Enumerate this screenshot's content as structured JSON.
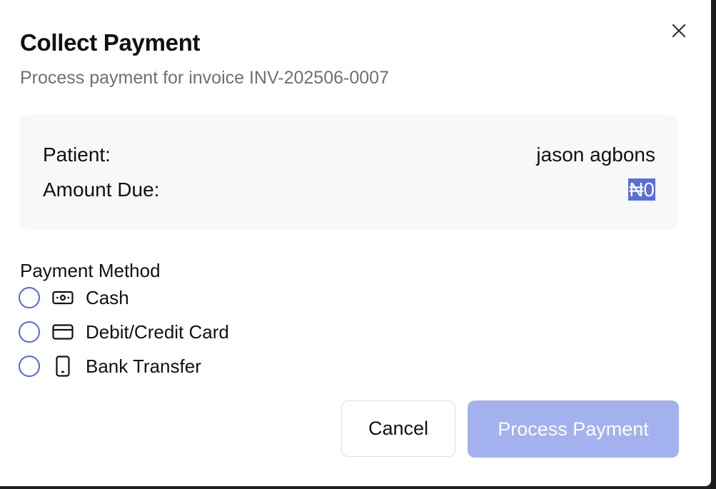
{
  "dialog": {
    "title": "Collect Payment",
    "subtitle": "Process payment for invoice INV-202506-0007",
    "close_icon": "close-icon"
  },
  "summary": {
    "patient_label": "Patient:",
    "patient_value": "jason agbons",
    "amount_label": "Amount Due:",
    "amount_value": "₦0"
  },
  "payment_method": {
    "label": "Payment Method",
    "options": [
      {
        "label": "Cash",
        "icon": "banknote-icon",
        "selected": false
      },
      {
        "label": "Debit/Credit Card",
        "icon": "credit-card-icon",
        "selected": false
      },
      {
        "label": "Bank Transfer",
        "icon": "smartphone-icon",
        "selected": false
      }
    ]
  },
  "actions": {
    "cancel_label": "Cancel",
    "process_label": "Process Payment",
    "process_enabled": false
  },
  "colors": {
    "accent": "#5468d4",
    "process_disabled_bg": "#a3b1ee",
    "summary_bg": "#f7f8fa",
    "selection_highlight": "#5a6fd0"
  }
}
